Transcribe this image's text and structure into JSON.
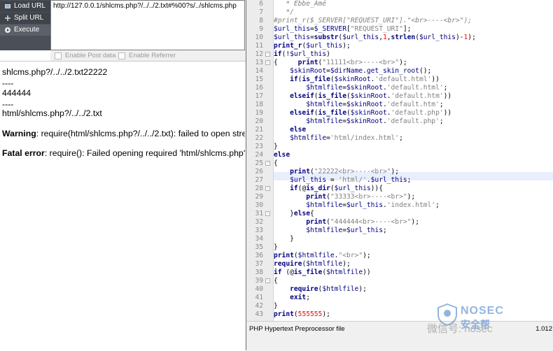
{
  "hackbar": {
    "buttons": [
      {
        "label": "Load URL",
        "icon": "load-url-icon"
      },
      {
        "label": "Split URL",
        "icon": "split-url-icon"
      },
      {
        "label": "Execute",
        "icon": "execute-icon"
      }
    ],
    "url_value": "http://127.0.0.1/shlcms.php?/../../2.txt#%00?s/../shlcms.php",
    "options": [
      {
        "label": "Enable Post data"
      },
      {
        "label": "Enable Referrer"
      }
    ]
  },
  "page_output": {
    "line1": "shlcms.php?/../../2.txt22222",
    "line2": "----",
    "line3": "444444",
    "line4": "----",
    "line5": "html/shlcms.php?/../../2.txt",
    "warning_label": "Warning",
    "warning_text": ": require(html/shlcms.php?/../../2.txt): failed to open stre",
    "fatal_label": "Fatal error",
    "fatal_text": ": require(): Failed opening required 'html/shlcms.php?/"
  },
  "editor": {
    "line_numbers": [
      "6",
      "7",
      "8",
      "9",
      "10",
      "11",
      "12",
      "13",
      "14",
      "15",
      "16",
      "17",
      "18",
      "19",
      "20",
      "21",
      "22",
      "23",
      "24",
      "25",
      "26",
      "27",
      "28",
      "29",
      "30",
      "31",
      "32",
      "33",
      "34",
      "35",
      "36",
      "37",
      "38",
      "39",
      "40",
      "41",
      "42",
      "43"
    ],
    "status_text": "PHP Hypertext Preprocessor file",
    "status_right": "1.012"
  },
  "watermark": {
    "brand": "NOSEC",
    "brand_cn": "安全帮",
    "account": "微信号: nosec"
  },
  "colors": {
    "keyword": "#000080",
    "string": "#808080",
    "number": "#ff0000",
    "hackbar_bg": "#4b4f57"
  }
}
